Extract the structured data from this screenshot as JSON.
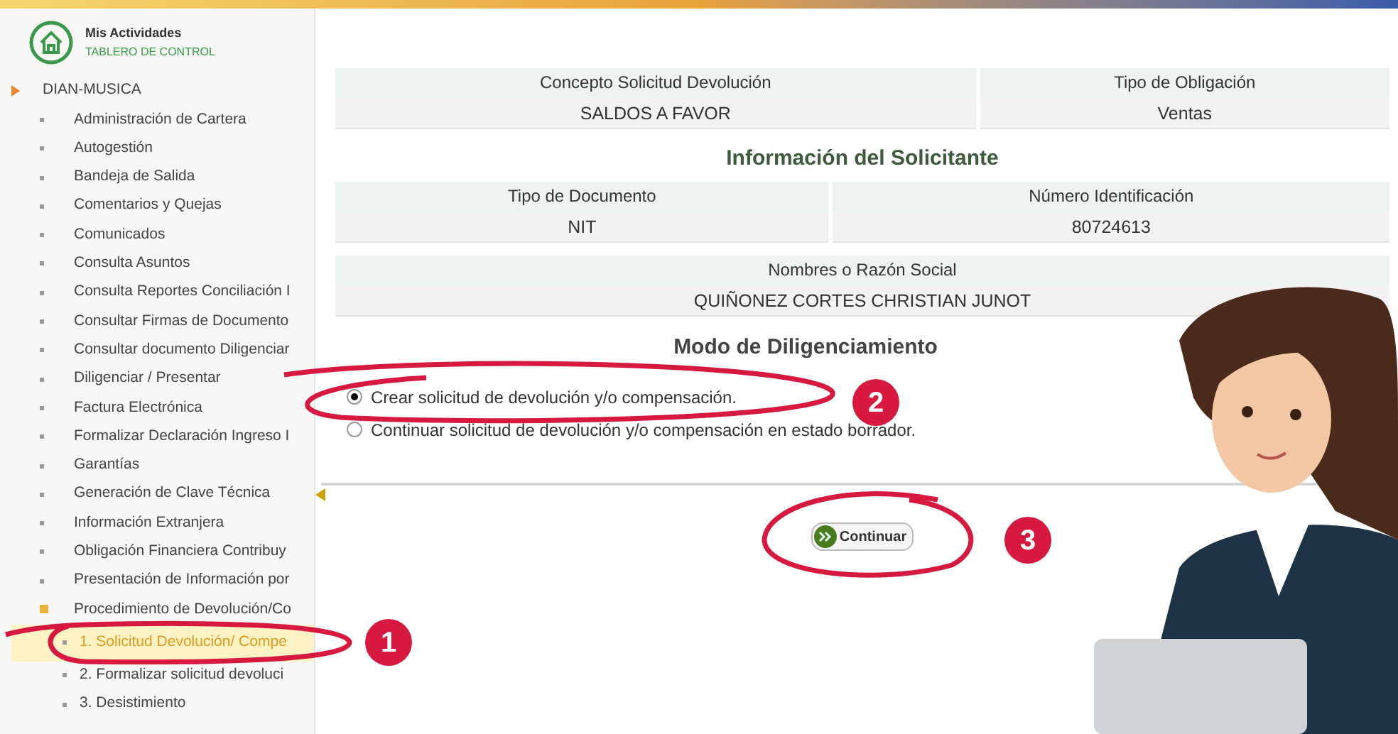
{
  "header": {
    "title": "Mis Actividades",
    "subtitle": "TABLERO DE CONTROL"
  },
  "menu": {
    "label": "DIAN-MUSICA",
    "children": [
      {
        "label": "Administración de Cartera",
        "selected": false
      },
      {
        "label": "Autogestión",
        "selected": false
      },
      {
        "label": "Bandeja de Salida",
        "selected": false
      },
      {
        "label": "Comentarios y Quejas",
        "selected": false
      },
      {
        "label": "Comunicados",
        "selected": false
      },
      {
        "label": "Consulta Asuntos",
        "selected": false
      },
      {
        "label": "Consulta Reportes Conciliación I",
        "selected": false
      },
      {
        "label": "Consultar Firmas de Documento",
        "selected": false
      },
      {
        "label": "Consultar documento Diligenciar",
        "selected": false
      },
      {
        "label": "Diligenciar / Presentar",
        "selected": false
      },
      {
        "label": "Factura Electrónica",
        "selected": false
      },
      {
        "label": "Formalizar Declaración Ingreso I",
        "selected": false
      },
      {
        "label": "Garantías",
        "selected": false
      },
      {
        "label": "Generación de Clave Técnica",
        "selected": false
      },
      {
        "label": "Información Extranjera",
        "selected": false
      },
      {
        "label": "Obligación Financiera Contribuy",
        "selected": false
      },
      {
        "label": "Presentación de Información por",
        "selected": false
      },
      {
        "label": "Procedimiento de Devolución/Co",
        "selected": false,
        "children": [
          {
            "label": "1. Solicitud Devolución/ Compe",
            "selected": true
          },
          {
            "label": "2. Formalizar solicitud devoluci",
            "selected": false
          },
          {
            "label": "3. Desistimiento",
            "selected": false
          }
        ]
      }
    ]
  },
  "sections": [
    {
      "columns": [
        {
          "header": "Concepto Solicitud Devolución",
          "value": "SALDOS A FAVOR"
        },
        {
          "header": "Tipo de Obligación",
          "value": "Ventas"
        }
      ]
    },
    {
      "title": "Información del Solicitante",
      "columns": [
        {
          "header": "Tipo de Documento",
          "value": "NIT"
        },
        {
          "header": "Número Identificación",
          "value": "80724613"
        }
      ]
    },
    {
      "columns": [
        {
          "header": "Nombres o Razón Social",
          "value": "QUIÑONEZ CORTES CHRISTIAN JUNOT"
        }
      ]
    }
  ],
  "mode": {
    "title": "Modo de Diligenciamiento",
    "options": [
      {
        "label": "Crear solicitud de devolución y/o compensación.",
        "selected": true
      },
      {
        "label": "Continuar solicitud de devolución y/o compensación en estado borrador.",
        "selected": false
      }
    ]
  },
  "button": "Continuar",
  "step_markers": [
    "1",
    "2",
    "3"
  ]
}
